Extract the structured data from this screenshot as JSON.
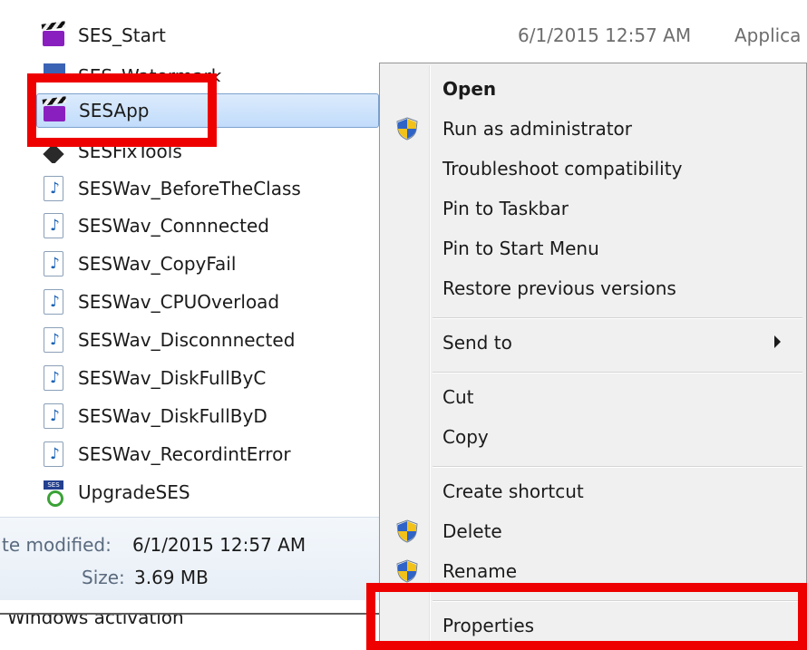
{
  "files": [
    {
      "name": "SES_Start",
      "icon": "clapper-icon",
      "date": "6/1/2015 12:57 AM",
      "type": "Applica"
    },
    {
      "name": "SES_Watermark",
      "icon": "watermark-icon"
    },
    {
      "name": "SESApp",
      "icon": "clapper-icon",
      "selected": true
    },
    {
      "name": "SESFixTools",
      "icon": "tools-icon"
    },
    {
      "name": "SESWav_BeforeTheClass",
      "icon": "audio-file-icon"
    },
    {
      "name": "SESWav_Connnected",
      "icon": "audio-file-icon"
    },
    {
      "name": "SESWav_CopyFail",
      "icon": "audio-file-icon"
    },
    {
      "name": "SESWav_CPUOverload",
      "icon": "audio-file-icon"
    },
    {
      "name": "SESWav_Disconnnected",
      "icon": "audio-file-icon"
    },
    {
      "name": "SESWav_DiskFullByC",
      "icon": "audio-file-icon"
    },
    {
      "name": "SESWav_DiskFullByD",
      "icon": "audio-file-icon"
    },
    {
      "name": "SESWav_RecordintError",
      "icon": "audio-file-icon"
    },
    {
      "name": "UpgradeSES",
      "icon": "upgrade-icon"
    }
  ],
  "details": {
    "modified_label": "te modified:",
    "modified_value": "6/1/2015 12:57 AM",
    "size_label": "Size:",
    "size_value": "3.69 MB"
  },
  "bottom": {
    "text": "Windows activation"
  },
  "menu": {
    "open": "Open",
    "run_as_admin": "Run as administrator",
    "troubleshoot": "Troubleshoot compatibility",
    "pin_taskbar": "Pin to Taskbar",
    "pin_start": "Pin to Start Menu",
    "restore": "Restore previous versions",
    "send_to": "Send to",
    "cut": "Cut",
    "copy": "Copy",
    "create_shortcut": "Create shortcut",
    "delete": "Delete",
    "rename": "Rename",
    "properties": "Properties"
  },
  "colors": {
    "highlight": "#ee0000",
    "selection": "#c1dcfb",
    "menu_bg": "#f0f0f0"
  }
}
